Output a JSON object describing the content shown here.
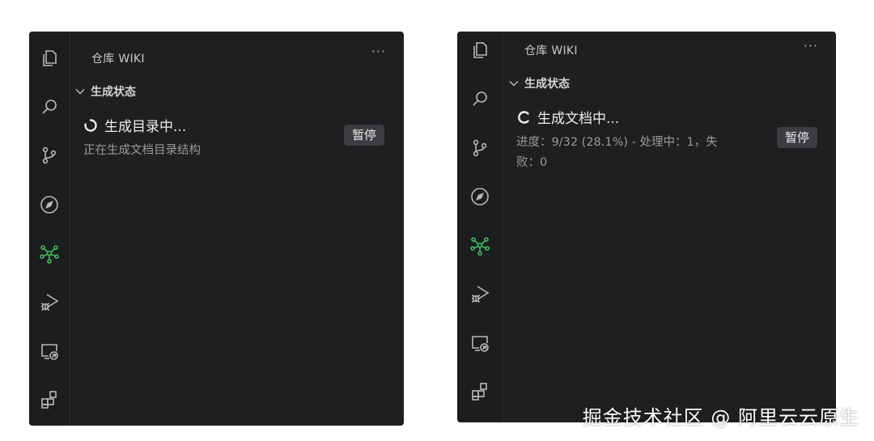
{
  "left_panel": {
    "title": "仓库 WIKI",
    "more": "···",
    "section_title": "生成状态",
    "status_text": "生成目录中...",
    "detail_text": "正在生成文档目录结构",
    "pause_label": "暂停"
  },
  "right_panel": {
    "title": "仓库 WIKI",
    "more": "···",
    "section_title": "生成状态",
    "status_text": "生成文档中...",
    "detail_line1": "进度：9/32 (28.1%) - 处理中：1，失",
    "detail_line2": "败：0",
    "pause_label": "暂停"
  },
  "activity_icons": [
    "explorer-icon",
    "search-icon",
    "source-control-icon",
    "compass-icon",
    "wiki-graph-icon",
    "run-debug-icon",
    "remote-explorer-icon",
    "extensions-icon"
  ],
  "colors": {
    "panel_bg": "#1e1f21",
    "active_icon": "#3fbf5a",
    "icon": "#b8b8b8"
  },
  "watermark": "掘金技术社区 @ 阿里云云原生"
}
